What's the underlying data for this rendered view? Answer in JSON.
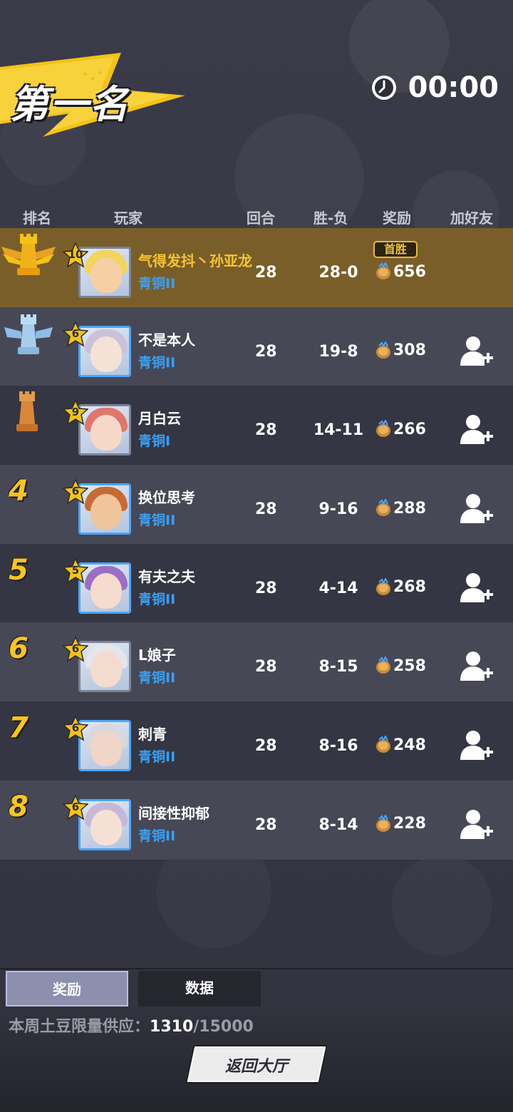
{
  "title": "第一名",
  "timer": "00:00",
  "columns": {
    "rank": "排名",
    "player": "玩家",
    "rounds": "回合",
    "win_loss": "胜-负",
    "reward": "奖励",
    "add_friend": "加好友"
  },
  "players": [
    {
      "rank": "1",
      "rank_icon": "gold-rook-winged-icon",
      "level": "10",
      "name": "气得发抖丶孙亚龙",
      "tier": "青铜II",
      "rounds": "28",
      "win_loss": "28-0",
      "reward": "656",
      "badge": "首胜"
    },
    {
      "rank": "2",
      "rank_icon": "silver-rook-winged-icon",
      "level": "6",
      "name": "不是本人",
      "tier": "青铜II",
      "rounds": "28",
      "win_loss": "19-8",
      "reward": "308"
    },
    {
      "rank": "3",
      "rank_icon": "bronze-rook-icon",
      "level": "9",
      "name": "月白云",
      "tier": "青铜I",
      "rounds": "28",
      "win_loss": "14-11",
      "reward": "266"
    },
    {
      "rank": "4",
      "level": "6",
      "name": "换位思考",
      "tier": "青铜II",
      "rounds": "28",
      "win_loss": "9-16",
      "reward": "288"
    },
    {
      "rank": "5",
      "level": "5",
      "name": "有夫之夫",
      "tier": "青铜II",
      "rounds": "28",
      "win_loss": "4-14",
      "reward": "268"
    },
    {
      "rank": "6",
      "level": "6",
      "name": "L娘子",
      "tier": "青铜II",
      "rounds": "28",
      "win_loss": "8-15",
      "reward": "258"
    },
    {
      "rank": "7",
      "level": "6",
      "name": "刺青",
      "tier": "青铜II",
      "rounds": "28",
      "win_loss": "8-16",
      "reward": "248"
    },
    {
      "rank": "8",
      "level": "6",
      "name": "间接性抑郁",
      "tier": "青铜II",
      "rounds": "28",
      "win_loss": "8-14",
      "reward": "228"
    }
  ],
  "tabs": {
    "reward": "奖励",
    "data": "数据"
  },
  "supply": {
    "label": "本周土豆限量供应：",
    "current": "1310",
    "max": "/15000"
  },
  "return_button": "返回大厅",
  "colors": {
    "gold": "#f6c531",
    "tier_blue": "#3aa0f2",
    "first_row": "#7a5e2a"
  }
}
